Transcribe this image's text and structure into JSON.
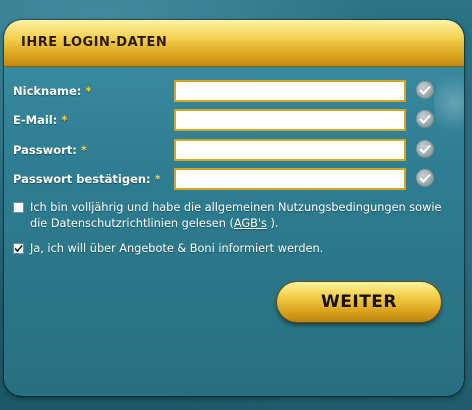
{
  "form": {
    "title": "IHRE LOGIN-DATEN",
    "required_marker": "*",
    "fields": [
      {
        "label": "Nickname:",
        "value": ""
      },
      {
        "label": "E-Mail:",
        "value": ""
      },
      {
        "label": "Passwort:",
        "value": ""
      },
      {
        "label": "Passwort bestätigen:",
        "value": ""
      }
    ],
    "checkboxes": [
      {
        "text": "Ich bin volljährig und habe die allgemeinen Nutzungsbedingungen sowie die Datenschutzrichtlinien gelesen (",
        "link": "AGB's",
        "text_after": ").",
        "checked": false
      },
      {
        "text": "Ja, ich will über Angebote & Boni informiert werden.",
        "checked": true
      }
    ],
    "submit_label": "WEITER"
  },
  "colors": {
    "accent_gold": "#f3cf4f",
    "input_border": "#d8a51e",
    "panel_teal": "#2e7d92"
  }
}
